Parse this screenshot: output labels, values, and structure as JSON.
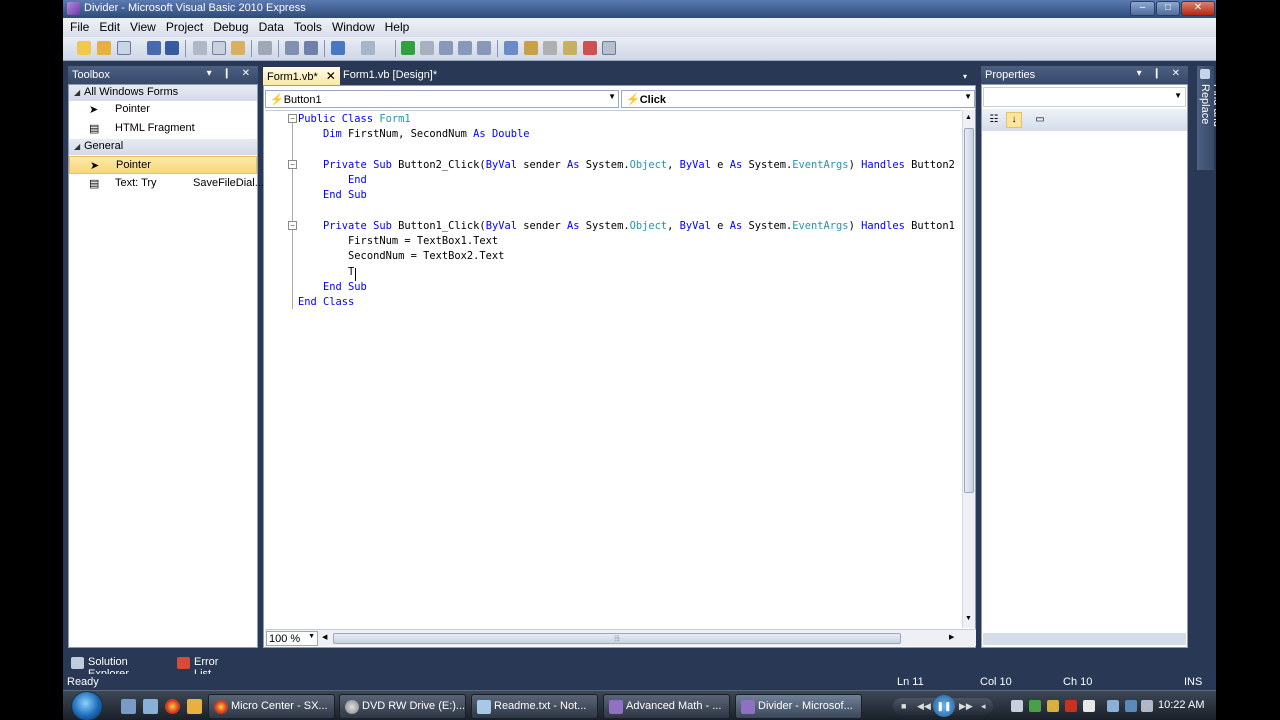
{
  "window": {
    "title": "Divider - Microsoft Visual Basic 2010 Express",
    "min": "–",
    "max": "□",
    "close": "✕"
  },
  "menu": [
    "File",
    "Edit",
    "View",
    "Project",
    "Debug",
    "Data",
    "Tools",
    "Window",
    "Help"
  ],
  "toolbox": {
    "title": "Toolbox",
    "controls": "▾ ❙ ✕",
    "group1": "All Windows Forms",
    "group1_items": [
      "Pointer",
      "HTML Fragment"
    ],
    "group2": "General",
    "group2_items": [
      "Pointer",
      "Text: Try"
    ],
    "group2_item2_extra": "SaveFileDial..."
  },
  "tabs": {
    "active": "Form1.vb*",
    "active_close": "✕",
    "second": "Form1.vb [Design]*",
    "dropdown": "▾"
  },
  "editor": {
    "object_combo": "Button1",
    "event_combo": "Click",
    "zoom": "100 %",
    "code": {
      "l1a": "Public Class ",
      "l1b": "Form1",
      "l2a": "    Dim ",
      "l2b": "FirstNum, SecondNum ",
      "l2c": "As Double",
      "l4a": "    Private Sub ",
      "l4b": "Button2_Click(",
      "l4c": "ByVal",
      "l4d": " sender ",
      "l4e": "As",
      "l4f": " System.",
      "l4g": "Object",
      "l4h": ", ",
      "l4i": "ByVal",
      "l4j": " e ",
      "l4k": "As",
      "l4l": " System.",
      "l4m": "EventArgs",
      "l4n": ") ",
      "l4o": "Handles",
      "l4p": " Button2",
      "l5": "        End",
      "l6": "    End Sub",
      "l8a": "    Private Sub ",
      "l8b": "Button1_Click(",
      "l8c": "ByVal",
      "l8d": " sender ",
      "l8e": "As",
      "l8f": " System.",
      "l8g": "Object",
      "l8h": ", ",
      "l8i": "ByVal",
      "l8j": " e ",
      "l8k": "As",
      "l8l": " System.",
      "l8m": "EventArgs",
      "l8n": ") ",
      "l8o": "Handles",
      "l8p": " Button1",
      "l9": "        FirstNum = TextBox1.Text",
      "l10": "        SecondNum = TextBox2.Text",
      "l11": "        T",
      "l12": "    End Sub",
      "l13": "End Class"
    }
  },
  "properties": {
    "title": "Properties",
    "controls": "▾ ❙ ✕"
  },
  "side_tab": "Find and Replace",
  "bottom_tabs": [
    "Solution Explorer",
    "Error List"
  ],
  "status": {
    "text": "Ready",
    "ln": "Ln 11",
    "col": "Col 10",
    "ch": "Ch 10",
    "ins": "INS"
  },
  "taskbar": {
    "items": [
      "Micro Center - SX...",
      "DVD RW Drive (E:)...",
      "Readme.txt - Not...",
      "Advanced Math - ...",
      "Divider - Microsof..."
    ],
    "clock": "10:22 AM"
  },
  "colors": {
    "keyword": "#0000ff",
    "type": "#2b91af",
    "ide_background": "#293955"
  }
}
